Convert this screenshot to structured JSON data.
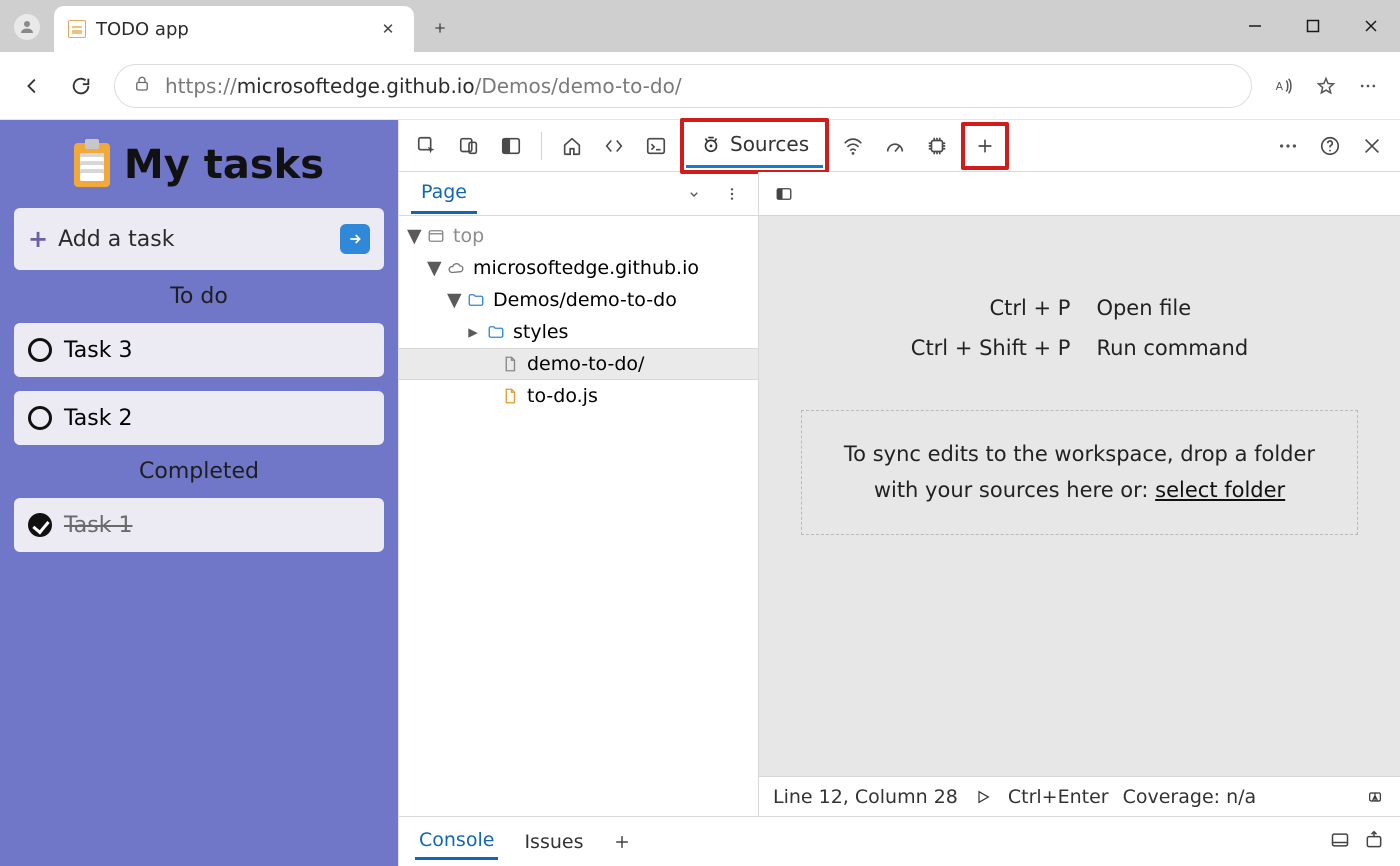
{
  "browser": {
    "tab_title": "TODO app",
    "url_prefix": "https://",
    "url_host": "microsoftedge.github.io",
    "url_path": "/Demos/demo-to-do/"
  },
  "app": {
    "title": "My tasks",
    "add_task_label": "Add a task",
    "todo_heading": "To do",
    "completed_heading": "Completed",
    "tasks_todo": [
      "Task 3",
      "Task 2"
    ],
    "tasks_done": [
      "Task 1"
    ]
  },
  "devtools": {
    "active_tab": "Sources",
    "navigator_tab": "Page",
    "tree": {
      "top": "top",
      "domain": "microsoftedge.github.io",
      "folder": "Demos/demo-to-do",
      "styles": "styles",
      "index": "demo-to-do/",
      "js": "to-do.js"
    },
    "hints": {
      "open_file_key": "Ctrl + P",
      "open_file_label": "Open file",
      "run_cmd_key": "Ctrl + Shift + P",
      "run_cmd_label": "Run command"
    },
    "drop_hint_1": "To sync edits to the workspace, drop a folder",
    "drop_hint_2": "with your sources here or: ",
    "select_folder": "select folder",
    "status": {
      "position": "Line 12, Column 28",
      "run_hint": "Ctrl+Enter",
      "coverage": "Coverage: n/a"
    },
    "drawer": {
      "console": "Console",
      "issues": "Issues"
    }
  }
}
